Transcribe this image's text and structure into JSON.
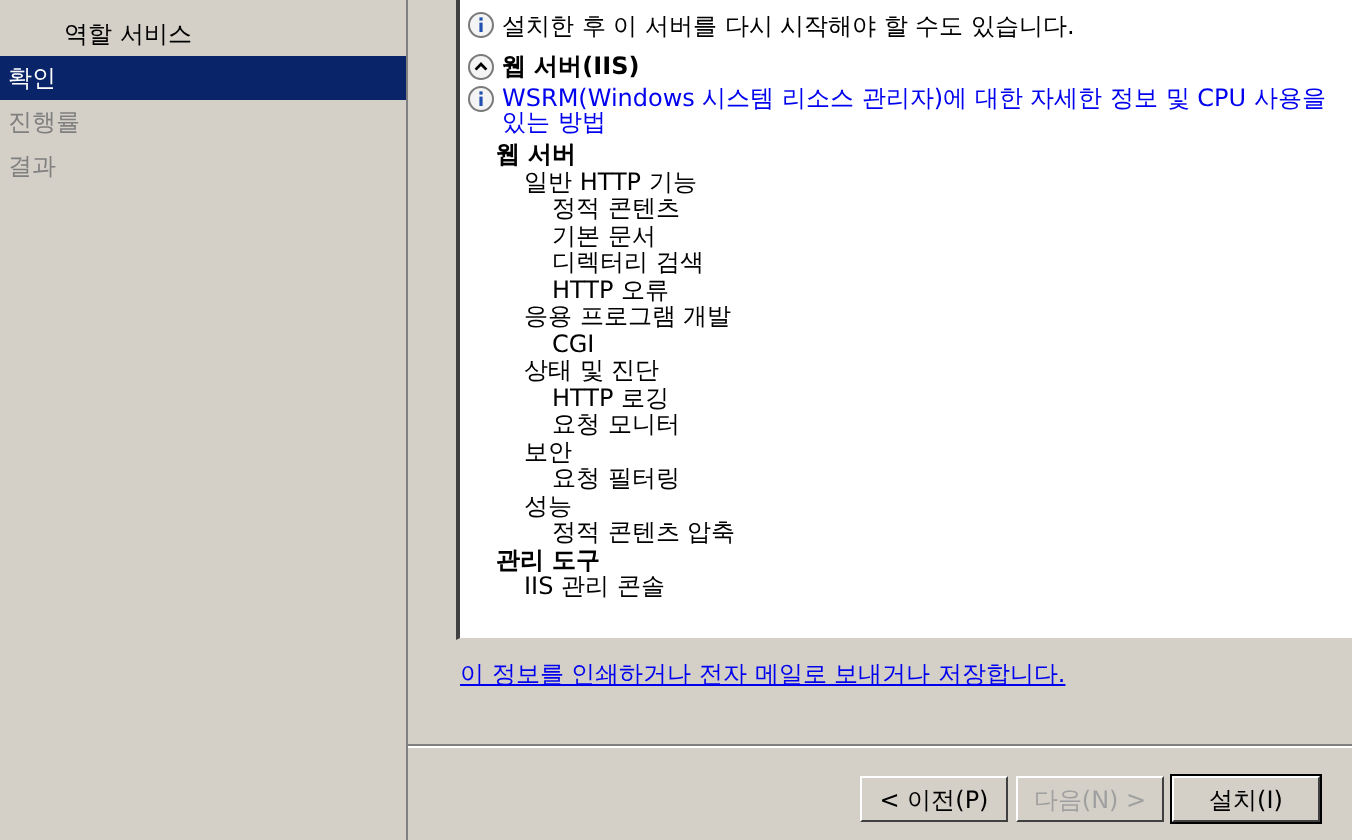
{
  "sidebar": {
    "items": [
      {
        "label": "역할 서비스",
        "selected": false,
        "disabled": false,
        "indented": true
      },
      {
        "label": "확인",
        "selected": true,
        "disabled": false,
        "indented": false
      },
      {
        "label": "진행률",
        "selected": false,
        "disabled": true,
        "indented": false
      },
      {
        "label": "결과",
        "selected": false,
        "disabled": true,
        "indented": false
      }
    ]
  },
  "notice": "설치한 후 이 서버를 다시 시작해야 할 수도 있습니다.",
  "section": {
    "title": "웹 서버(IIS)",
    "expanded": true,
    "info_link": [
      "WSRM(Windows 시스템 리소스 관리자)에 대한 자세한 정보 및 CPU 사용을",
      "있는 방법"
    ],
    "tree": [
      {
        "label": "웹 서버",
        "children": [
          {
            "label": "일반 HTTP 기능",
            "children": [
              {
                "label": "정적 콘텐츠"
              },
              {
                "label": "기본 문서"
              },
              {
                "label": "디렉터리 검색"
              },
              {
                "label": "HTTP 오류"
              }
            ]
          },
          {
            "label": "응용 프로그램 개발",
            "children": [
              {
                "label": "CGI"
              }
            ]
          },
          {
            "label": "상태 및 진단",
            "children": [
              {
                "label": "HTTP 로깅"
              },
              {
                "label": "요청 모니터"
              }
            ]
          },
          {
            "label": "보안",
            "children": [
              {
                "label": "요청 필터링"
              }
            ]
          },
          {
            "label": "성능",
            "children": [
              {
                "label": "정적 콘텐츠 압축"
              }
            ]
          }
        ]
      },
      {
        "label": "관리 도구",
        "children": [
          {
            "label": "IIS 관리 콘솔"
          }
        ]
      }
    ]
  },
  "print_link": "이 정보를 인쇄하거나 전자 메일로 보내거나 저장합니다.",
  "buttons": [
    {
      "label": "< 이전(P)",
      "disabled": false
    },
    {
      "label": "다음(N) >",
      "disabled": true
    },
    {
      "label": "설치(I)",
      "disabled": false,
      "default": true
    }
  ]
}
